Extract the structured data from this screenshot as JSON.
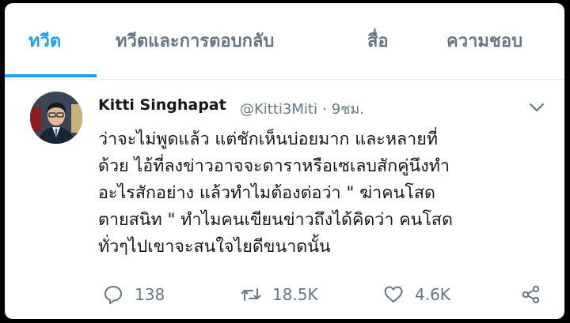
{
  "tabs": [
    {
      "label": "ทวีต"
    },
    {
      "label": "ทวีตและการตอบกลับ"
    },
    {
      "label": "สื่อ"
    },
    {
      "label": "ความชอบ"
    }
  ],
  "tweet": {
    "author_name": "Kitti Singhapat",
    "handle": "@Kitti3Miti",
    "separator": "·",
    "time": "9ชม.",
    "lines": [
      "ว่าจะไม่พูดแล้ว แต่ชักเห็นบ่อยมาก และหลายที่",
      "ด้วย ไอ้ที่ลงข่าวอาจจะดาราหรือเซเลบสักคู่นึงทำ",
      "อะไรสักอย่าง แล้วทำไมต้องต่อว่า \" ฆ่าคนโสด",
      "ตายสนิท \" ทำไมคนเขียนข่าวถึงได้คิดว่า คนโสด",
      "ทั่วๆไปเขาจะสนใจไยดีขนาดนั้น"
    ]
  },
  "actions": {
    "replies": "138",
    "retweets": "18.5K",
    "likes": "4.6K"
  },
  "colors": {
    "accent": "#1da1f2",
    "secondary_text": "#657786",
    "primary_text": "#14171a"
  },
  "icons": [
    "reply-icon",
    "retweet-icon",
    "like-icon",
    "share-icon",
    "chevron-down-icon"
  ]
}
